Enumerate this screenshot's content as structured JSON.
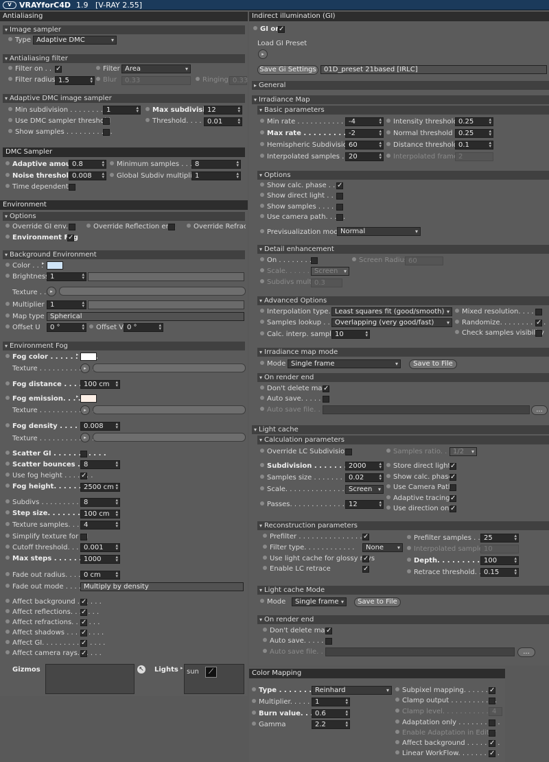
{
  "app": {
    "name": "VRAYforC4D",
    "version": "1.9",
    "vray_version": "[V-RAY 2.55]",
    "logo": "V"
  },
  "left": {
    "antialiasing": {
      "header": "Antialiasing",
      "image_sampler": {
        "title": "Image sampler",
        "type_label": "Type",
        "type_value": "Adaptive DMC"
      },
      "aa_filter": {
        "title": "Antialiasing filter",
        "filter_on_label": "Filter on . .",
        "filter_on": true,
        "filter_label": "Filter",
        "filter_value": "Area",
        "radius_label": "Filter radius",
        "radius_value": "1.5",
        "blur_label": "Blur",
        "blur_value": "0.33",
        "ringing_label": "Ringing",
        "ringing_value": "0.33"
      },
      "adaptive_dmc": {
        "title": "Adaptive DMC image sampler",
        "min_sub_label": "Min subdivision . . . . . . . . . .",
        "min_sub": "1",
        "max_sub_label": "Max subdivision",
        "max_sub": "12",
        "use_dmc_label": "Use DMC sampler threshold",
        "use_dmc": false,
        "threshold_label": "Threshold. . . . . .",
        "threshold": "0.01",
        "show_samples_label": "Show samples . . . . . . . . . . .",
        "show_samples": false
      }
    },
    "dmc_sampler": {
      "header": "DMC Sampler",
      "adaptive_amount_label": "Adaptive amount",
      "adaptive_amount": "0.8",
      "min_samples_label": "Minimum samples . . . . .",
      "min_samples": "8",
      "noise_threshold_label": "Noise threshold",
      "noise_threshold": "0.008",
      "global_subdiv_label": "Global Subdiv multiplier",
      "global_subdiv": "1",
      "time_dependent_label": "Time dependent",
      "time_dependent": false
    },
    "environment": {
      "header": "Environment",
      "options_title": "Options",
      "override_gi_label": "Override GI env.",
      "override_refl_label": "Override Reflection env.",
      "override_refr_label": "Override Refracti",
      "env_fog_label": "Environment Fog",
      "env_fog": true,
      "bg_title": "Background Environment",
      "color_label": "Color . . .",
      "bg_color": "#cfe4f6",
      "brightness_label": "Brightness",
      "brightness": "1",
      "texture_label": "Texture . . .",
      "multiplier_label": "Multiplier",
      "multiplier": "1",
      "map_type_label": "Map type",
      "map_type": "Spherical",
      "offset_u_label": "Offset U",
      "offset_u": "0 °",
      "offset_v_label": "Offset V",
      "offset_v": "0 °"
    },
    "fog": {
      "title": "Environment Fog",
      "fog_color_label": "Fog color . . . . . . . . . .",
      "fog_color": "#ffffff",
      "texture_label": "Texture . . . . . . . . . . . . .",
      "fog_distance_label": "Fog distance . . . . . . . .",
      "fog_distance": "100 cm",
      "fog_emission_label": "Fog emission. . . . . . .",
      "fog_emission": "#fcefe6",
      "fog_density_label": "Fog density . . . . . . . .",
      "fog_density": "0.008",
      "scatter_gi_label": "Scatter GI . . . . . . . . . . .",
      "scatter_gi": false,
      "scatter_bounces_label": "Scatter bounces . . . . .",
      "scatter_bounces": "8",
      "use_fog_height_label": "Use fog height . . . . . . .",
      "use_fog_height": true,
      "fog_height_label": "Fog height. . . . . . . . . . .",
      "fog_height": "2500 cm",
      "subdivs_label": "Subdivs . . . . . . . . . . . . .",
      "subdivs": "8",
      "step_size_label": "Step size. . . . . . . . . . . .",
      "step_size": "100 cm",
      "texture_samples_label": "Texture samples. . . . . .",
      "texture_samples": "4",
      "simplify_label": "Simplify texture for GI",
      "simplify": false,
      "cutoff_label": "Cutoff threshold. . . . . .",
      "cutoff": "0.001",
      "max_steps_label": "Max steps . . . . . . . . . . .",
      "max_steps": "1000",
      "fade_radius_label": "Fade out radius. . . . . . .",
      "fade_radius": "0 cm",
      "fade_mode_label": "Fade out mode . . . . . .",
      "fade_mode": "Multiply by density",
      "affect_bg_label": "Affect background . . . . . .",
      "affect_refl_label": "Affect reflections. . . . . . .",
      "affect_refr_label": "Affect refractions. . . . . . .",
      "affect_shadows_label": "Affect shadows . . . . . . . . .",
      "affect_gi_label": "Affect GI. . . . . . . . . . . . . . .",
      "affect_cam_label": "Affect camera rays. . . . . .",
      "gizmos_label": "Gizmos",
      "lights_label": "Lights",
      "lights_item": "sun"
    }
  },
  "right": {
    "gi": {
      "header": "Indirect illumination (GI)",
      "gi_on_label": "GI on",
      "gi_on": true,
      "load_preset_label": "Load GI Preset",
      "save_gi_label": "Save Gi Settings",
      "preset_name": "01D_preset 21based [IRLC]",
      "general_title": "General"
    },
    "irradiance": {
      "title": "Irradiance Map",
      "basic_title": "Basic parameters",
      "min_rate_label": "Min rate . . . . . . . . . . . .",
      "min_rate": "-4",
      "intensity_label": "Intensity threshold",
      "intensity": "0.25",
      "max_rate_label": "Max rate . . . . . . . . . . .",
      "max_rate": "-2",
      "normal_label": "Normal threshold . . .",
      "normal": "0.25",
      "hemi_label": "Hemispheric Subdivision",
      "hemi": "60",
      "distance_label": "Distance threshold",
      "distance": "0.1",
      "interp_label": "Interpolated samples . . .",
      "interp": "20",
      "interp_frames_label": "Interpolated frames",
      "interp_frames": "2",
      "options_title": "Options",
      "show_phase_label": "Show calc. phase . . . .",
      "show_direct_label": "Show direct light . . .",
      "show_samples_label": "Show samples . . . . . .",
      "use_cam_label": "Use camera path. . . . .",
      "preview_label": "Previsualization mode",
      "preview_value": "Normal",
      "detail_title": "Detail enhancement",
      "on_label": "On . . . . . . . . .",
      "screen_radius_label": "Screen Radius",
      "screen_radius": "60",
      "scale_label": "Scale. . . . . . . .",
      "scale_value": "Screen",
      "subdivs_mult_label": "Subdivs mult.",
      "subdivs_mult": "0.3",
      "adv_title": "Advanced Options",
      "interp_type_label": "Interpolation type. . .",
      "interp_type": "Least squares fit (good/smooth)",
      "mixed_label": "Mixed resolution. . . . . .",
      "lookup_label": "Samples lookup . . . .",
      "lookup": "Overlapping (very good/fast)",
      "randomize_label": "Randomize. . . . . . . . . . .",
      "calc_interp_label": "Calc. interp. samples",
      "calc_interp": "10",
      "check_vis_label": "Check samples visibility",
      "mode_title": "Irradiance map mode",
      "mode_label": "Mode",
      "mode_value": "Single frame",
      "save_file_label": "Save to File",
      "render_end_title": "On render end",
      "dont_delete_label": "Don't delete map",
      "auto_save_label": "Auto save. . . . . . .",
      "auto_save_file_label": "Auto save file. . . . . .",
      "browse_label": "..."
    },
    "lightcache": {
      "title": "Light cache",
      "calc_title": "Calculation parameters",
      "override_label": "Override LC Subdivision",
      "samples_ratio_label": "Samples ratio. . .",
      "samples_ratio": "1/2",
      "subdiv_label": "Subdivision . . . . . . . . . .",
      "subdiv": "2000",
      "store_direct_label": "Store direct light",
      "sample_size_label": "Samples size . . . . . . . . .",
      "sample_size": "0.02",
      "show_phase_label": "Show calc. phase",
      "scale_label": "Scale. . . . . . . . . . . . . . . .",
      "scale_value": "Screen",
      "use_cam_label": "Use Camera Path",
      "adaptive_label": "Adaptive tracing",
      "passes_label": "Passes. . . . . . . . . . . . . . .",
      "passes": "12",
      "direction_label": "Use direction only",
      "recon_title": "Reconstruction parameters",
      "prefilter_label": "Prefilter . . . . . . . . . . . . . . . .",
      "prefilter_samples_label": "Prefilter samples . . . .",
      "prefilter_samples": "25",
      "filter_type_label": "Filter type. . . . . . . . . . . .",
      "filter_type": "None",
      "interp_samples_label": "Interpolated samples",
      "interp_samples": "10",
      "glossy_label": "Use light cache for glossy rays",
      "depth_label": "Depth. . . . . . . . . . . . . .",
      "depth": "100",
      "retrace_label": "Enable LC retrace",
      "retrace_th_label": "Retrace threshold. . . .",
      "retrace_th": "0.15",
      "mode_title": "Light cache Mode",
      "mode_label": "Mode",
      "mode_value": "Single frame",
      "save_file_label": "Save to File",
      "render_end_title": "On render end",
      "dont_delete_label": "Don't delete map",
      "auto_save_label": "Auto save. . . . . . .",
      "auto_save_file_label": "Auto save file. . . . . .",
      "browse_label": "..."
    }
  },
  "color_mapping": {
    "header": "Color Mapping",
    "type_label": "Type . . . . . . . . . . . .",
    "type_value": "Reinhard",
    "subpixel_label": "Subpixel mapping. . . . . . .",
    "multiplier_label": "Multiplier. . . . . . . . .",
    "multiplier": "1",
    "clamp_label": "Clamp output . . . . . . . . . . .",
    "clamp_level_label": "Clamp level. . . . . . . . . . . .",
    "clamp_level": "4",
    "burn_label": "Burn value. . . . . . . .",
    "burn": "0.6",
    "adapt_label": "Adaptation only . . . . . . . . . .",
    "gamma_label": "Gamma",
    "gamma": "2.2",
    "enable_adapt_label": "Enable Adaptation in Editor",
    "affect_bg_label": "Affect background . . . . . . . .",
    "linear_label": "Linear WorkFlow. . . . . . . . . ."
  },
  "icons": {
    "check": "✓",
    "spinner": "⬍",
    "caret": "▾",
    "expand": "▸",
    "collapse": "▾",
    "play": "▸"
  }
}
